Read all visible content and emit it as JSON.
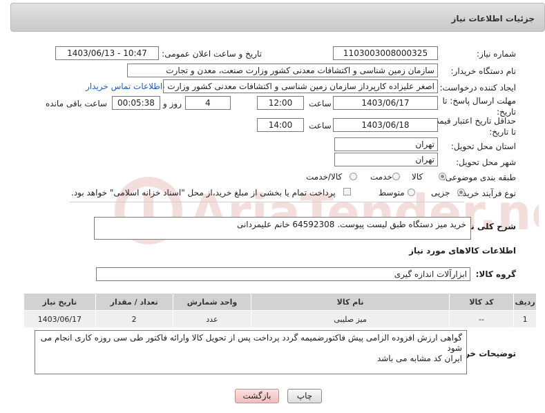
{
  "page_title": "جزئیات اطلاعات نیاز",
  "need_number": {
    "label": "شماره نیاز:",
    "value": "1103003008000325"
  },
  "announce": {
    "label": "تاریخ و ساعت اعلان عمومی:",
    "value": "1403/06/13 - 10:47"
  },
  "buyer_org": {
    "label": "نام دستگاه خریدار:",
    "value": "سازمان زمین شناسی و اکتشافات معدنی کشور وزارت صنعت، معدن و تجارت"
  },
  "requester": {
    "label": "ایجاد کننده درخواست:",
    "value": "اصغر علیزاده کارپرداز سازمان زمین شناسی و اکتشافات معدنی کشور وزارت صنعت",
    "link": "اطلاعات تماس خریدار"
  },
  "deadline": {
    "label": "مهلت ارسال پاسخ: تا تاریخ:",
    "date": "1403/06/17",
    "time_label": "ساعت",
    "time": "12:00",
    "days": "4",
    "days_label": "روز و",
    "remaining": "00:05:38",
    "remaining_label": "ساعت باقی مانده"
  },
  "validity": {
    "label": "حداقل تاریخ اعتبار قیمت: تا تاریخ:",
    "date": "1403/06/18",
    "time_label": "ساعت",
    "time": "14:00"
  },
  "province": {
    "label": "استان محل تحویل:",
    "value": "تهران"
  },
  "city": {
    "label": "شهر محل تحویل:",
    "value": "تهران"
  },
  "category": {
    "label": "طبقه بندی موضوعی:",
    "options": [
      "کالا",
      "خدمت",
      "کالا/خدمت"
    ],
    "selected": "کالا"
  },
  "purchase_process": {
    "label": "نوع فرآیند خرید :",
    "options": [
      "جزیی",
      "متوسط"
    ],
    "selected": "جزیی",
    "note": "پرداخت تمام یا بخشی از مبلغ خرید،از محل \"اسناد خزانه اسلامی\" خواهد بود."
  },
  "description": {
    "label": "شرح کلی نیاز:",
    "value": "خرید میز دستگاه طبق لیست پیوست. 64592308 خانم علیمردانی"
  },
  "goods_section": {
    "title": "اطلاعات کالاهای مورد نیاز"
  },
  "goods_group": {
    "label": "گروه کالا:",
    "value": "ابزارآلات اندازه گیری"
  },
  "table": {
    "headers": [
      "ردیف",
      "کد کالا",
      "نام کالا",
      "واحد شمارش",
      "تعداد / مقدار",
      "تاریخ نیاز"
    ],
    "rows": [
      [
        "1",
        "--",
        "میز صلیبی",
        "عدد",
        "2",
        "1403/06/17"
      ]
    ]
  },
  "buyer_notes": {
    "label": "توضیحات خریدار:",
    "value": "گواهی ارزش افزوده الزامی پیش فاکتورضمیمه گردد پرداخت پس از تحویل کالا وارائه فاکتور طی سی روزه کاری انجام می شود\nایران کد مشابه می باشد"
  },
  "buttons": {
    "print": "چاپ",
    "back": "بازگشت"
  },
  "watermark_text": "AriaTender.neT",
  "colors": {
    "link": "#1a5fc0",
    "back_button": "#f1bcbc",
    "watermark": "#c0392b"
  }
}
